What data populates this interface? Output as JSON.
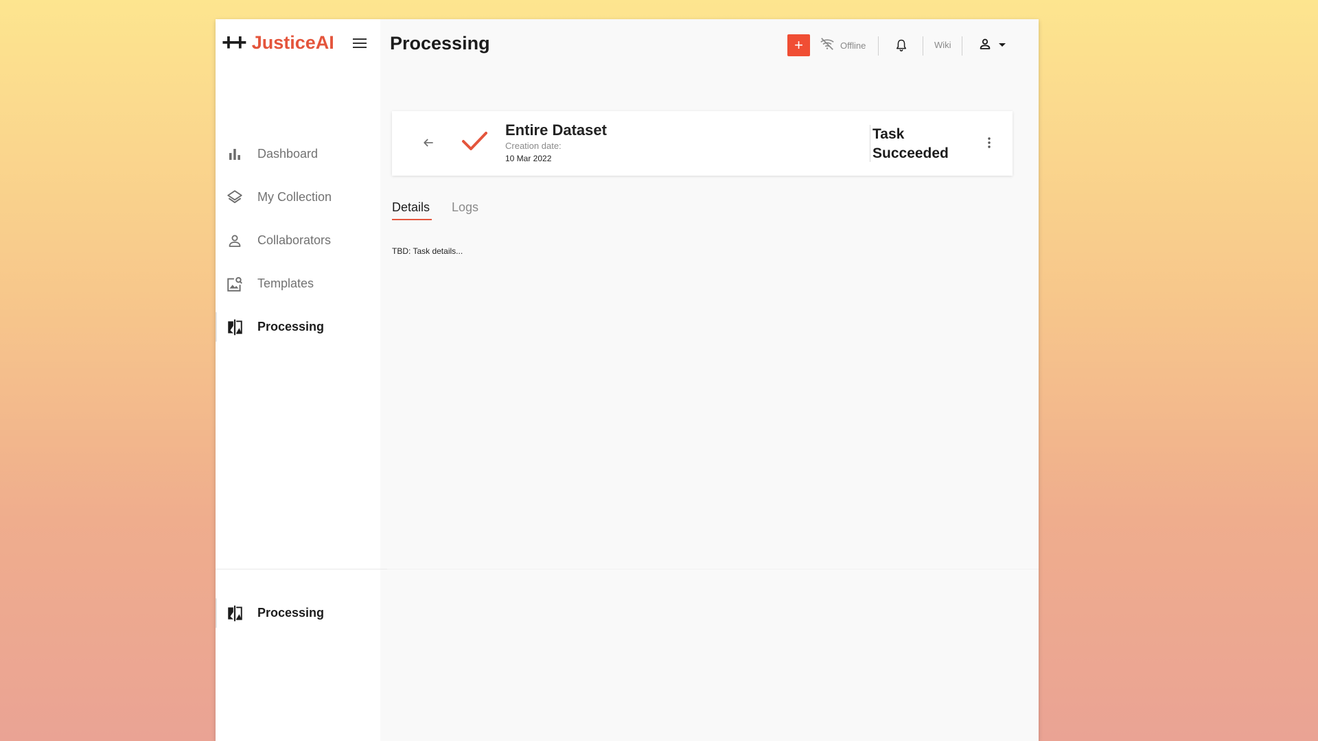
{
  "brand": {
    "plus": "++",
    "name": "JusticeAI"
  },
  "header": {
    "title": "Processing"
  },
  "toolbar": {
    "add_label": "+",
    "offline_label": "Offline",
    "wiki_label": "Wiki"
  },
  "sidebar": {
    "items": [
      {
        "label": "Dashboard",
        "icon": "bar-chart-icon"
      },
      {
        "label": "My Collection",
        "icon": "layers-icon"
      },
      {
        "label": "Collaborators",
        "icon": "person-icon"
      },
      {
        "label": "Templates",
        "icon": "image-search-icon"
      },
      {
        "label": "Processing",
        "icon": "compare-icon",
        "active": true
      }
    ],
    "bottom_item": {
      "label": "Processing",
      "icon": "compare-icon"
    }
  },
  "task": {
    "title": "Entire Dataset",
    "date_label": "Creation date:",
    "date": "10 Mar 2022",
    "status": "Task Succeeded"
  },
  "tabs": [
    {
      "label": "Details",
      "active": true
    },
    {
      "label": "Logs",
      "active": false
    }
  ],
  "details": {
    "text": "TBD: Task details..."
  },
  "colors": {
    "accent": "#e4553c",
    "add_button": "#f04e34"
  }
}
